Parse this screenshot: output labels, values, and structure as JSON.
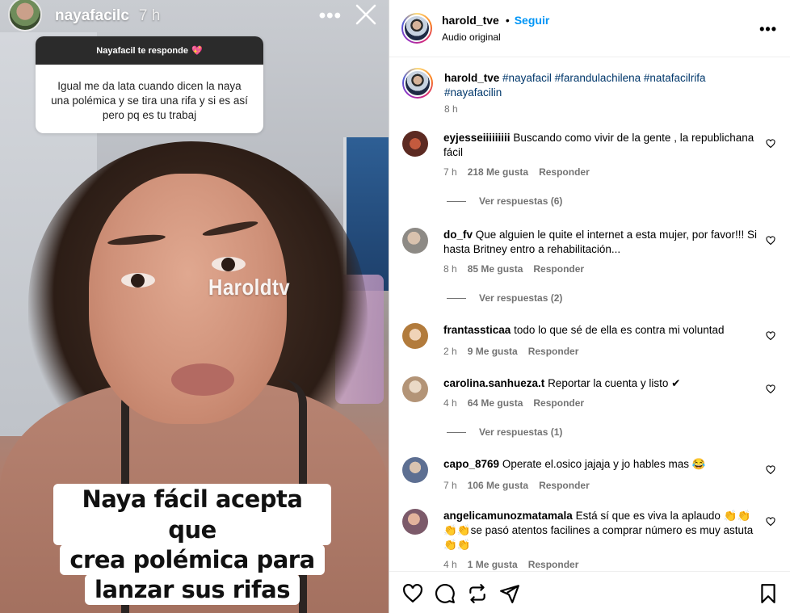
{
  "story": {
    "username": "nayafacilc",
    "time": "7 h",
    "more_label": "•••",
    "question_header": "Nayafacil te responde",
    "question_text": "Igual me da lata cuando dicen la naya una polémica y se tira una rifa y si es así pero pq es tu trabaj",
    "watermark": "Haroldtv",
    "caption_lines": [
      "Naya fácil acepta que",
      "crea polémica para",
      "lanzar sus rifas"
    ]
  },
  "header": {
    "username": "harold_tve",
    "separator": "•",
    "follow_label": "Seguir",
    "audio_label": "Audio original",
    "more_label": "•••"
  },
  "post": {
    "username": "harold_tve",
    "hashtags": "#nayafacil #farandulachilena #natafacilrifa #nayafacilin",
    "time": "8 h"
  },
  "comments": [
    {
      "user": "eyjesseiiiiiiiii",
      "text": "Buscando como vivir de la gente , la republichana fácil",
      "time": "7 h",
      "likes": "218 Me gusta",
      "reply": "Responder",
      "view_replies": "Ver respuestas (6)",
      "avatar_color": "#7a3b2e"
    },
    {
      "user": "do_fv",
      "text": "Que alguien le quite el internet a esta mujer, por favor!!! Si hasta Britney entro a rehabilitación...",
      "time": "8 h",
      "likes": "85 Me gusta",
      "reply": "Responder",
      "view_replies": "Ver respuestas (2)",
      "avatar_color": "#a9a49a"
    },
    {
      "user": "frantassticaa",
      "text": "todo lo que sé de ella es contra mi voluntad",
      "time": "2 h",
      "likes": "9 Me gusta",
      "reply": "Responder",
      "view_replies": "",
      "avatar_color": "#c48a4a"
    },
    {
      "user": "carolina.sanhueza.t",
      "text": "Reportar la cuenta y listo ✔",
      "time": "4 h",
      "likes": "64 Me gusta",
      "reply": "Responder",
      "view_replies": "Ver respuestas (1)",
      "avatar_color": "#c9b29a"
    },
    {
      "user": "capo_8769",
      "text": "Operate el.osico jajaja y jo hables mas 😂",
      "time": "7 h",
      "likes": "106 Me gusta",
      "reply": "Responder",
      "view_replies": "",
      "avatar_color": "#8f9bb0"
    },
    {
      "user": "angelicamunozmatamala",
      "text": "Está sí que es viva la aplaudo 👏👏👏👏se pasó atentos facilines a comprar número es muy astuta 👏👏",
      "time": "4 h",
      "likes": "1 Me gusta",
      "reply": "Responder",
      "view_replies": "",
      "avatar_color": "#b5897a"
    }
  ],
  "colors": {
    "link": "#00376b",
    "follow": "#0095f6",
    "meta": "#737373",
    "check": "#7b5cc6"
  },
  "icons": [
    "heart-icon",
    "comment-icon",
    "repost-icon",
    "share-icon",
    "bookmark-icon",
    "close-icon"
  ]
}
